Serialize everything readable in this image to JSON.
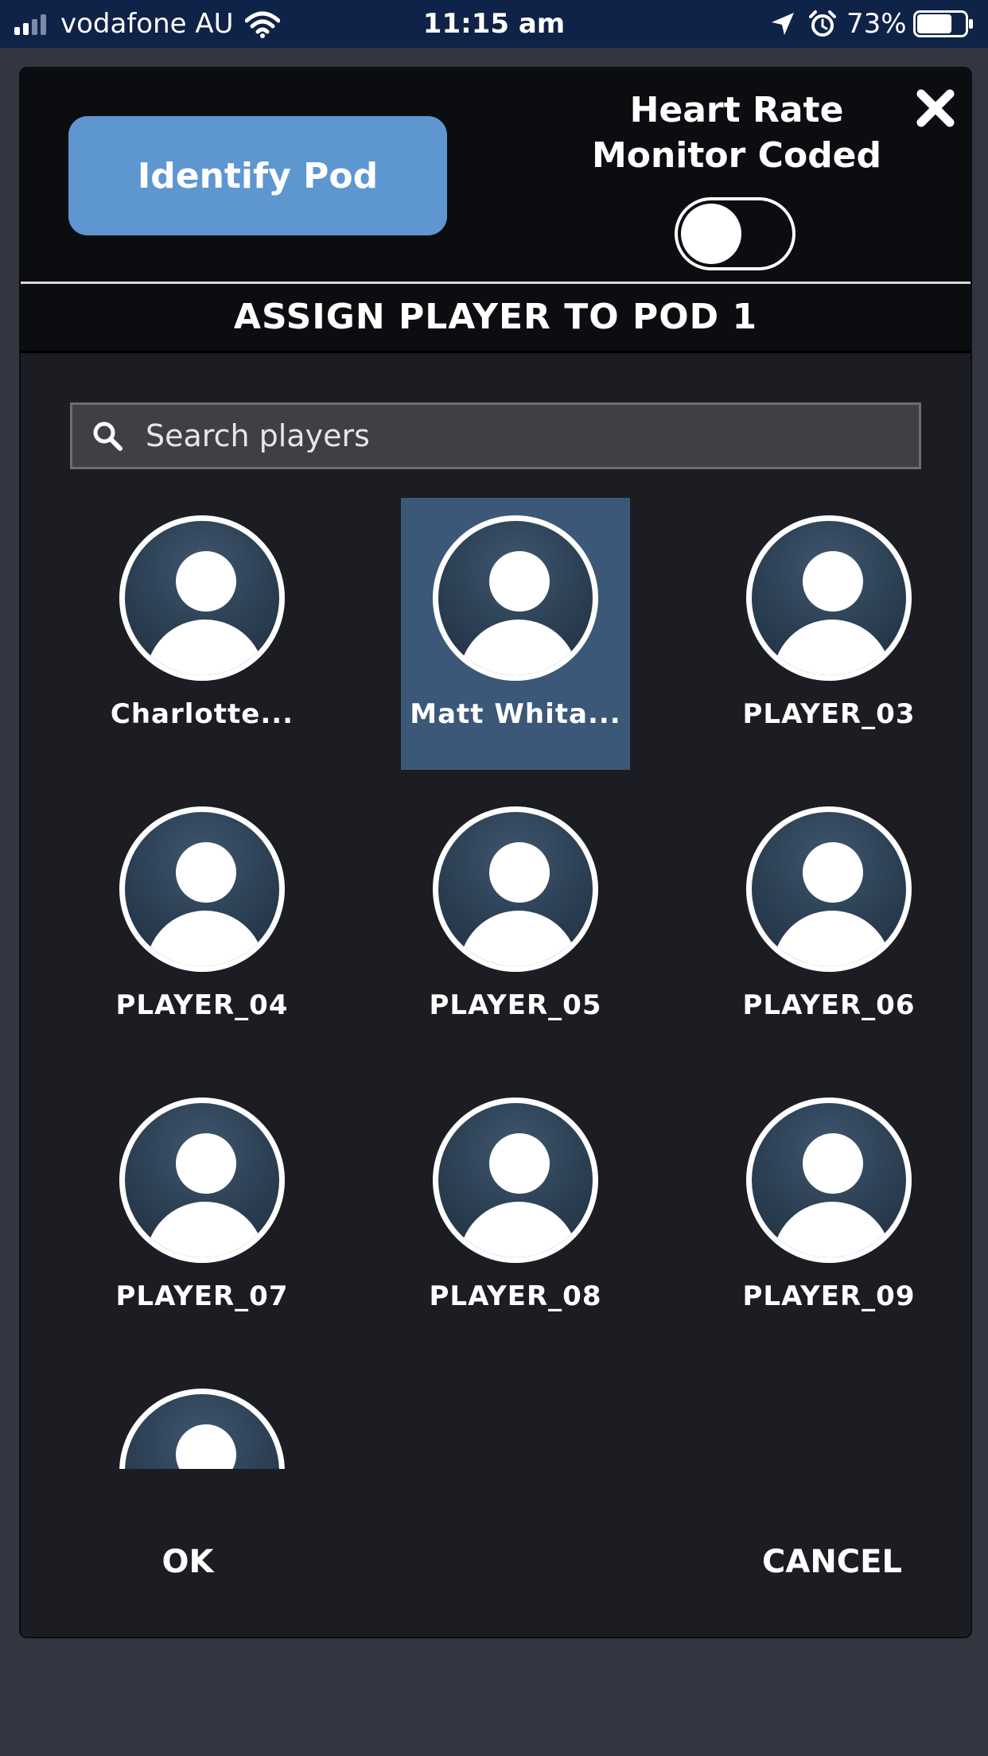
{
  "status_bar": {
    "carrier": "vodafone AU",
    "time": "11:15 am",
    "battery_percent": "73%",
    "battery_level": 0.73
  },
  "dialog": {
    "identify_button_label": "Identify Pod",
    "hr_label_line1": "Heart Rate",
    "hr_label_line2": "Monitor Coded",
    "hr_toggle_on": false,
    "title": "ASSIGN PLAYER TO POD 1",
    "search": {
      "placeholder": "Search players",
      "value": ""
    },
    "players": [
      {
        "name": "Charlotte...",
        "selected": false
      },
      {
        "name": "Matt Whita...",
        "selected": true
      },
      {
        "name": "PLAYER_03",
        "selected": false
      },
      {
        "name": "PLAYER_04",
        "selected": false
      },
      {
        "name": "PLAYER_05",
        "selected": false
      },
      {
        "name": "PLAYER_06",
        "selected": false
      },
      {
        "name": "PLAYER_07",
        "selected": false
      },
      {
        "name": "PLAYER_08",
        "selected": false
      },
      {
        "name": "PLAYER_09",
        "selected": false
      }
    ],
    "ok_label": "OK",
    "cancel_label": "CANCEL"
  },
  "colors": {
    "status_bar_bg": "#0f2247",
    "accent_button": "#5e96d0",
    "selected_cell": "#3c5878",
    "dialog_bg": "#1b1d22",
    "page_bg": "#333640"
  },
  "icons": {
    "close": "close-icon",
    "search": "search-icon",
    "avatar": "user-avatar-icon"
  }
}
